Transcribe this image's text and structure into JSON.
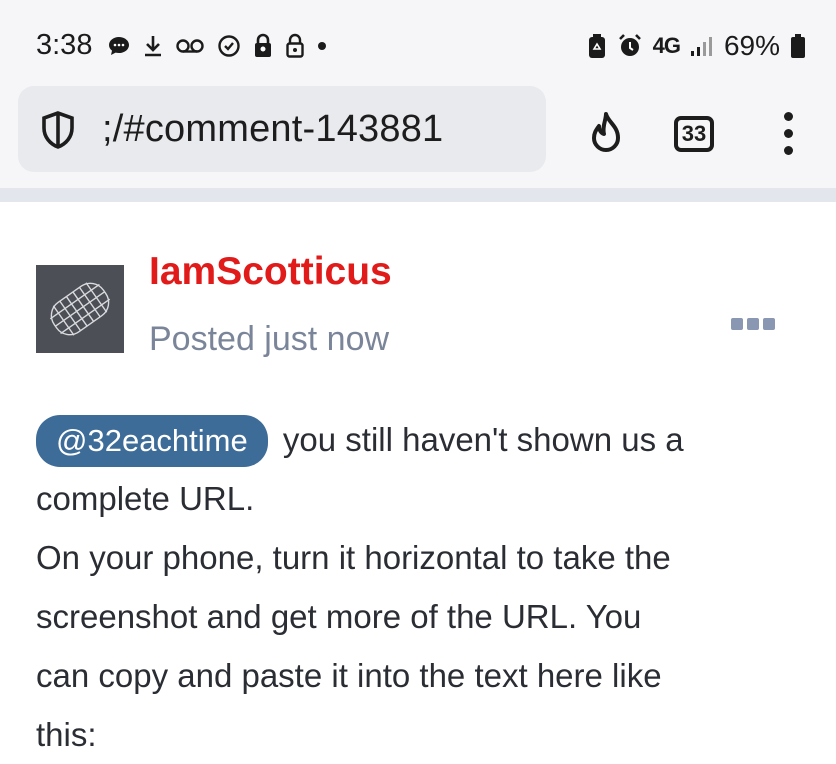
{
  "status_bar": {
    "time": "3:38",
    "left_icons": [
      "chat-icon",
      "download-icon",
      "voicemail-icon",
      "sync-icon",
      "lock-badge-icon",
      "lock-icon",
      "dot-icon"
    ],
    "network": "4G",
    "battery": "69%"
  },
  "browser": {
    "url": ";/#comment-143881",
    "tab_count": "33"
  },
  "comment": {
    "author": "IamScotticus",
    "posted": "Posted just now",
    "mention": "@32eachtime",
    "lines": [
      "you still haven't shown us a",
      "complete URL.",
      "On your phone, turn it horizontal to take the",
      "screenshot and get more of the URL.  You",
      "can copy and paste it into the text here like",
      "this:"
    ]
  },
  "colors": {
    "author": "#e11a1a",
    "mention_bg": "#3e6c98",
    "posted": "#7b8599"
  }
}
